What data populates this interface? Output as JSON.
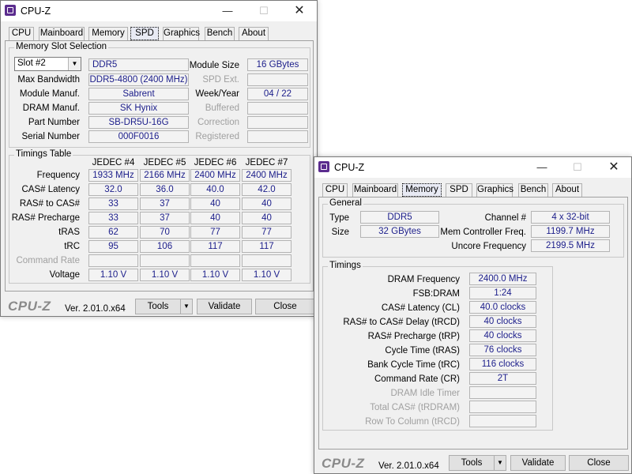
{
  "spd_window": {
    "title": "CPU-Z",
    "controls": {
      "minimize": "—",
      "maximize": "☐",
      "close": "✕"
    },
    "tabs": [
      "CPU",
      "Mainboard",
      "Memory",
      "SPD",
      "Graphics",
      "Bench",
      "About"
    ],
    "active_tab": "SPD",
    "slot_group": {
      "label": "Memory Slot Selection",
      "slot_value": "Slot #2",
      "memory_type": "DDR5",
      "rows": [
        {
          "label": "Max Bandwidth",
          "value": "DDR5-4800 (2400 MHz)"
        },
        {
          "label": "Module Manuf.",
          "value": "Sabrent"
        },
        {
          "label": "DRAM Manuf.",
          "value": "SK Hynix"
        },
        {
          "label": "Part Number",
          "value": "SB-DR5U-16G"
        },
        {
          "label": "Serial Number",
          "value": "000F0016"
        }
      ],
      "right_rows": [
        {
          "label": "Module Size",
          "value": "16 GBytes",
          "enabled": true
        },
        {
          "label": "SPD Ext.",
          "value": "",
          "enabled": false
        },
        {
          "label": "Week/Year",
          "value": "04 / 22",
          "enabled": true
        },
        {
          "label": "Buffered",
          "value": "",
          "enabled": false
        },
        {
          "label": "Correction",
          "value": "",
          "enabled": false
        },
        {
          "label": "Registered",
          "value": "",
          "enabled": false
        }
      ]
    },
    "timings_group": {
      "label": "Timings Table",
      "columns": [
        "JEDEC #4",
        "JEDEC #5",
        "JEDEC #6",
        "JEDEC #7"
      ],
      "rows": [
        {
          "label": "Frequency",
          "values": [
            "1933 MHz",
            "2166 MHz",
            "2400 MHz",
            "2400 MHz"
          ],
          "enabled": true
        },
        {
          "label": "CAS# Latency",
          "values": [
            "32.0",
            "36.0",
            "40.0",
            "42.0"
          ],
          "enabled": true
        },
        {
          "label": "RAS# to CAS#",
          "values": [
            "33",
            "37",
            "40",
            "40"
          ],
          "enabled": true
        },
        {
          "label": "RAS# Precharge",
          "values": [
            "33",
            "37",
            "40",
            "40"
          ],
          "enabled": true
        },
        {
          "label": "tRAS",
          "values": [
            "62",
            "70",
            "77",
            "77"
          ],
          "enabled": true
        },
        {
          "label": "tRC",
          "values": [
            "95",
            "106",
            "117",
            "117"
          ],
          "enabled": true
        },
        {
          "label": "Command Rate",
          "values": [
            "",
            "",
            "",
            ""
          ],
          "enabled": false
        },
        {
          "label": "Voltage",
          "values": [
            "1.10 V",
            "1.10 V",
            "1.10 V",
            "1.10 V"
          ],
          "enabled": true
        }
      ]
    },
    "footer": {
      "logo": "CPU-Z",
      "version": "Ver. 2.01.0.x64",
      "tools": "Tools",
      "validate": "Validate",
      "close": "Close"
    }
  },
  "mem_window": {
    "title": "CPU-Z",
    "controls": {
      "minimize": "—",
      "maximize": "☐",
      "close": "✕"
    },
    "tabs": [
      "CPU",
      "Mainboard",
      "Memory",
      "SPD",
      "Graphics",
      "Bench",
      "About"
    ],
    "active_tab": "Memory",
    "general_group": {
      "label": "General",
      "type_label": "Type",
      "type_value": "DDR5",
      "size_label": "Size",
      "size_value": "32 GBytes",
      "channel_label": "Channel #",
      "channel_value": "4 x 32-bit",
      "mcf_label": "Mem Controller Freq.",
      "mcf_value": "1199.7 MHz",
      "uncore_label": "Uncore Frequency",
      "uncore_value": "2199.5 MHz"
    },
    "timings_group": {
      "label": "Timings",
      "rows": [
        {
          "label": "DRAM Frequency",
          "value": "2400.0 MHz",
          "enabled": true
        },
        {
          "label": "FSB:DRAM",
          "value": "1:24",
          "enabled": true
        },
        {
          "label": "CAS# Latency (CL)",
          "value": "40.0 clocks",
          "enabled": true
        },
        {
          "label": "RAS# to CAS# Delay (tRCD)",
          "value": "40 clocks",
          "enabled": true
        },
        {
          "label": "RAS# Precharge (tRP)",
          "value": "40 clocks",
          "enabled": true
        },
        {
          "label": "Cycle Time (tRAS)",
          "value": "76 clocks",
          "enabled": true
        },
        {
          "label": "Bank Cycle Time (tRC)",
          "value": "116 clocks",
          "enabled": true
        },
        {
          "label": "Command Rate (CR)",
          "value": "2T",
          "enabled": true
        },
        {
          "label": "DRAM Idle Timer",
          "value": "",
          "enabled": false
        },
        {
          "label": "Total CAS# (tRDRAM)",
          "value": "",
          "enabled": false
        },
        {
          "label": "Row To Column (tRCD)",
          "value": "",
          "enabled": false
        }
      ]
    },
    "footer": {
      "logo": "CPU-Z",
      "version": "Ver. 2.01.0.x64",
      "tools": "Tools",
      "validate": "Validate",
      "close": "Close"
    }
  },
  "colors": {
    "value_text": "#1b1d8a",
    "disabled_text": "#a0a0a0",
    "icon_purple": "#5b2c8e"
  }
}
